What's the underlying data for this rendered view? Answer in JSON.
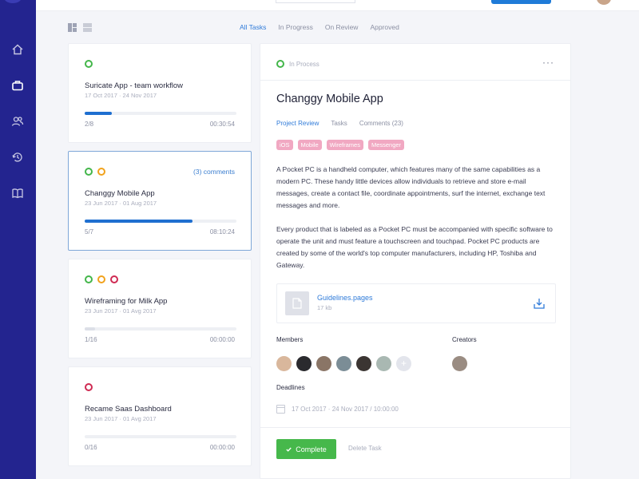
{
  "filters": [
    "All Tasks",
    "In Progress",
    "On Review",
    "Approved"
  ],
  "tasks": [
    {
      "title": "Suricate App - team workflow",
      "dates": "17 Oct 2017 · 24 Nov 2017",
      "count": "2/8",
      "time": "00:30:54",
      "progress": 0.18,
      "statuses": [
        "green"
      ],
      "comments": ""
    },
    {
      "title": "Changgy Mobile App",
      "dates": "23 Jun 2017 · 01 Aug 2017",
      "count": "5/7",
      "time": "08:10:24",
      "progress": 0.71,
      "statuses": [
        "green",
        "orange"
      ],
      "comments": "(3) comments"
    },
    {
      "title": "Wireframing for Milk App",
      "dates": "23 Jun 2017 · 01 Avg 2017",
      "count": "1/16",
      "time": "00:00:00",
      "progress": 0.07,
      "statuses": [
        "green",
        "orange",
        "red"
      ],
      "comments": ""
    },
    {
      "title": "Recame Saas Dashboard",
      "dates": "23 Jun 2017 · 01 Avg 2017",
      "count": "0/16",
      "time": "00:00:00",
      "progress": 0,
      "statuses": [
        "red"
      ],
      "comments": ""
    }
  ],
  "detail": {
    "status": "In Process",
    "more": "···",
    "title": "Changgy Mobile App",
    "tabs": [
      "Project Review",
      "Tasks",
      "Comments (23)"
    ],
    "tags": [
      "iOS",
      "Mobile",
      "Wireframes",
      "Messenger"
    ],
    "paragraph1": "A Pocket PC is a handheld computer, which features many of the same capabilities as a modern PC. These handy little devices allow individuals to retrieve and store e-mail messages, create a contact file, coordinate appointments, surf the internet, exchange text messages and more.",
    "paragraph2": "Every product that is labeled as a Pocket PC must be accompanied with specific software to operate the unit and must feature a touchscreen and touchpad. Pocket PC products are created by some of the world's top computer manufacturers, including HP, Toshiba and Gateway.",
    "file": {
      "name": "Guidelines.pages",
      "size": "17 kb"
    },
    "members_label": "Members",
    "creators_label": "Creators",
    "deadlines_label": "Deadlines",
    "deadline": "17 Oct 2017 · 24 Nov 2017 / 10:00:00",
    "add_member": "+",
    "complete_label": "Complete",
    "delete_label": "Delete Task"
  },
  "colors": {
    "sidebar": "#23248f",
    "accent": "#2f7bd9",
    "green": "#43b64a",
    "orange": "#f1a21c",
    "red": "#cf2a52",
    "tag": "#f1a8c2"
  },
  "icons": {
    "nav": [
      "home-icon",
      "briefcase-icon",
      "users-icon",
      "history-icon",
      "book-icon"
    ],
    "views": [
      "grid-view-icon",
      "list-view-icon"
    ]
  }
}
